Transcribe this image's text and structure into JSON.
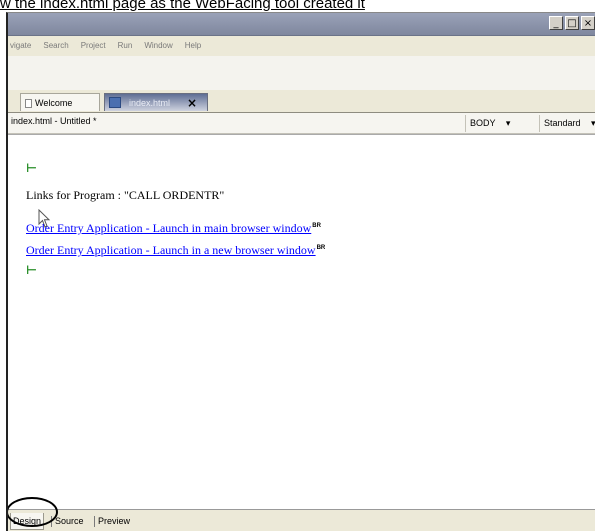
{
  "caption": "w the index.html page as the WebFacing tool created it",
  "window": {
    "controls": [
      "_",
      "□",
      "×"
    ]
  },
  "menubar": {
    "items": [
      "vigate",
      "Search",
      "Project",
      "Run",
      "Window",
      "Help"
    ]
  },
  "tabs": [
    {
      "label": "Welcome",
      "active": false
    },
    {
      "label": "index.html",
      "active": true,
      "close_symbol": "×"
    }
  ],
  "editor": {
    "file_label": "index.html - Untitled *",
    "tag_combo": "BODY",
    "style_combo": "Standard",
    "combo_arrow": "▾",
    "marker_symbol": "⊢",
    "heading": "Links for Program : \"CALL ORDENTR\"",
    "links": [
      {
        "text": "Order Entry Application - Launch in main browser window",
        "br": "BR"
      },
      {
        "text": "Order Entry Application - Launch in a new browser window",
        "br": "BR"
      }
    ]
  },
  "bottom_tabs": [
    "Design",
    "Source",
    "Preview"
  ],
  "icons": [
    "page-icon",
    "doc-icon",
    "cursor-arrow-icon",
    "paragraph-marker-icon"
  ]
}
